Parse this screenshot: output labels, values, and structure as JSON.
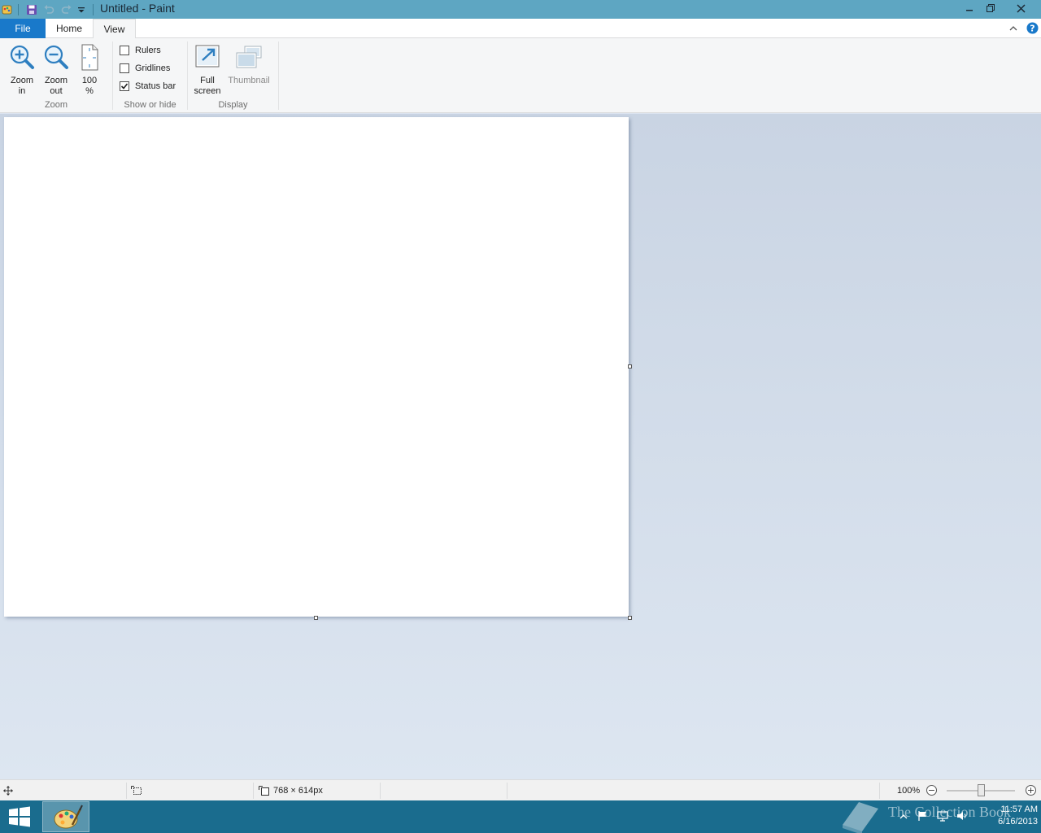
{
  "window": {
    "title": "Untitled - Paint"
  },
  "tabs": {
    "file": "File",
    "home": "Home",
    "view": "View"
  },
  "ribbon": {
    "zoom": {
      "zoom_in": "Zoom\nin",
      "zoom_out": "Zoom\nout",
      "hundred": "100\n%",
      "group_label": "Zoom"
    },
    "show_hide": {
      "rulers": "Rulers",
      "rulers_checked": false,
      "gridlines": "Gridlines",
      "gridlines_checked": false,
      "status_bar": "Status bar",
      "status_bar_checked": true,
      "group_label": "Show or hide"
    },
    "display": {
      "full_screen": "Full\nscreen",
      "thumbnail": "Thumbnail",
      "group_label": "Display"
    }
  },
  "status_bar": {
    "image_size": "768 × 614px",
    "zoom_level": "100%"
  },
  "taskbar": {
    "watermark": "The Collection Book",
    "time": "11:57 AM",
    "date": "6/16/2013"
  },
  "colors": {
    "title_bar": "#5ea6c2",
    "file_tab": "#1979ca",
    "workspace": "#d5deea",
    "taskbar": "#1a6c8e"
  }
}
